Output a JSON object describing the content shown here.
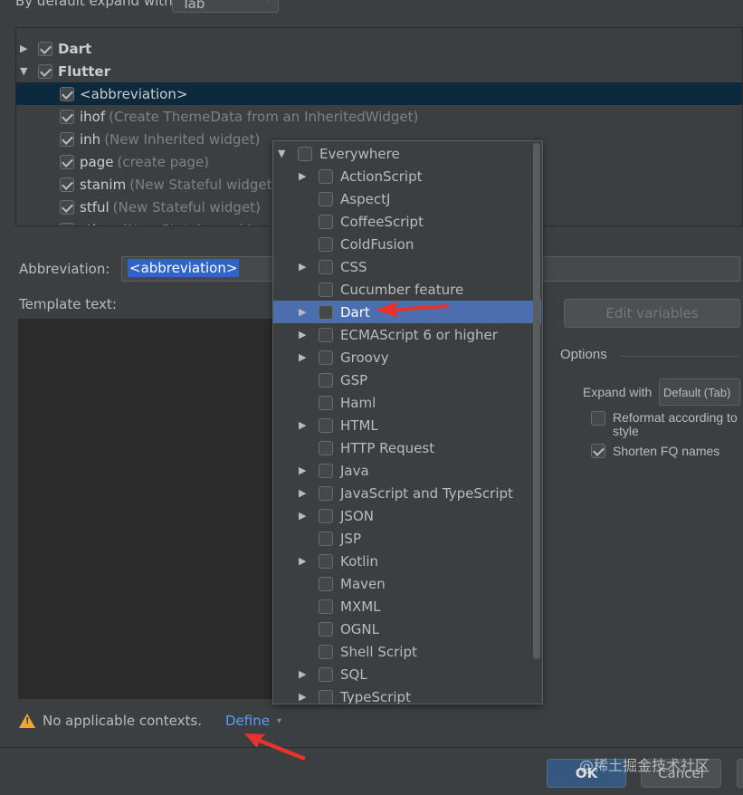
{
  "top": {
    "label": "By default expand with",
    "value": "Tab"
  },
  "tree": [
    {
      "name": "Dart",
      "level": 0,
      "expanded": false,
      "checked": true,
      "bold": true
    },
    {
      "name": "Flutter",
      "level": 0,
      "expanded": true,
      "checked": true,
      "bold": true
    },
    {
      "name": "<abbreviation>",
      "desc": "",
      "level": 1,
      "checked": true,
      "selected": true
    },
    {
      "name": "ihof",
      "desc": "(Create ThemeData from an InheritedWidget)",
      "level": 1,
      "checked": true
    },
    {
      "name": "inh",
      "desc": "(New Inherited widget)",
      "level": 1,
      "checked": true
    },
    {
      "name": "page",
      "desc": "(create page)",
      "level": 1,
      "checked": true
    },
    {
      "name": "stanim",
      "desc": "(New Stateful widget with AnimationController)",
      "level": 1,
      "checked": true
    },
    {
      "name": "stful",
      "desc": "(New Stateful widget)",
      "level": 1,
      "checked": true
    },
    {
      "name": "stless",
      "desc": "(New Stateless widget)",
      "level": 1,
      "checked": true
    }
  ],
  "abbreviation": {
    "label": "Abbreviation:",
    "value": "<abbreviation>"
  },
  "template_text": {
    "label": "Template text:"
  },
  "edit_variables": "Edit variables",
  "options": {
    "title": "Options",
    "expand_label": "Expand with",
    "expand_value": "Default (Tab)",
    "reformat": "Reformat according to style",
    "reformat_checked": false,
    "shorten": "Shorten FQ names",
    "shorten_checked": true
  },
  "contexts": [
    {
      "name": "Everywhere",
      "root": true,
      "expandable": true
    },
    {
      "name": "ActionScript",
      "expandable": true
    },
    {
      "name": "AspectJ"
    },
    {
      "name": "CoffeeScript"
    },
    {
      "name": "ColdFusion"
    },
    {
      "name": "CSS",
      "expandable": true
    },
    {
      "name": "Cucumber feature"
    },
    {
      "name": "Dart",
      "expandable": true,
      "highlighted": true
    },
    {
      "name": "ECMAScript 6 or higher",
      "expandable": true
    },
    {
      "name": "Groovy",
      "expandable": true
    },
    {
      "name": "GSP"
    },
    {
      "name": "Haml"
    },
    {
      "name": "HTML",
      "expandable": true
    },
    {
      "name": "HTTP Request"
    },
    {
      "name": "Java",
      "expandable": true
    },
    {
      "name": "JavaScript and TypeScript",
      "expandable": true
    },
    {
      "name": "JSON",
      "expandable": true
    },
    {
      "name": "JSP"
    },
    {
      "name": "Kotlin",
      "expandable": true
    },
    {
      "name": "Maven"
    },
    {
      "name": "MXML"
    },
    {
      "name": "OGNL"
    },
    {
      "name": "Shell Script"
    },
    {
      "name": "SQL",
      "expandable": true
    },
    {
      "name": "TypeScript",
      "expandable": true
    }
  ],
  "warning": {
    "text": "No applicable contexts.",
    "link": "Define"
  },
  "buttons": {
    "ok": "OK",
    "cancel": "Cancel"
  },
  "watermark": "@稀土掘金技术社区",
  "colors": {
    "selection": "#0d293e",
    "highlight": "#4b6eaf",
    "link": "#589df6",
    "arrow": "#e8322d"
  }
}
